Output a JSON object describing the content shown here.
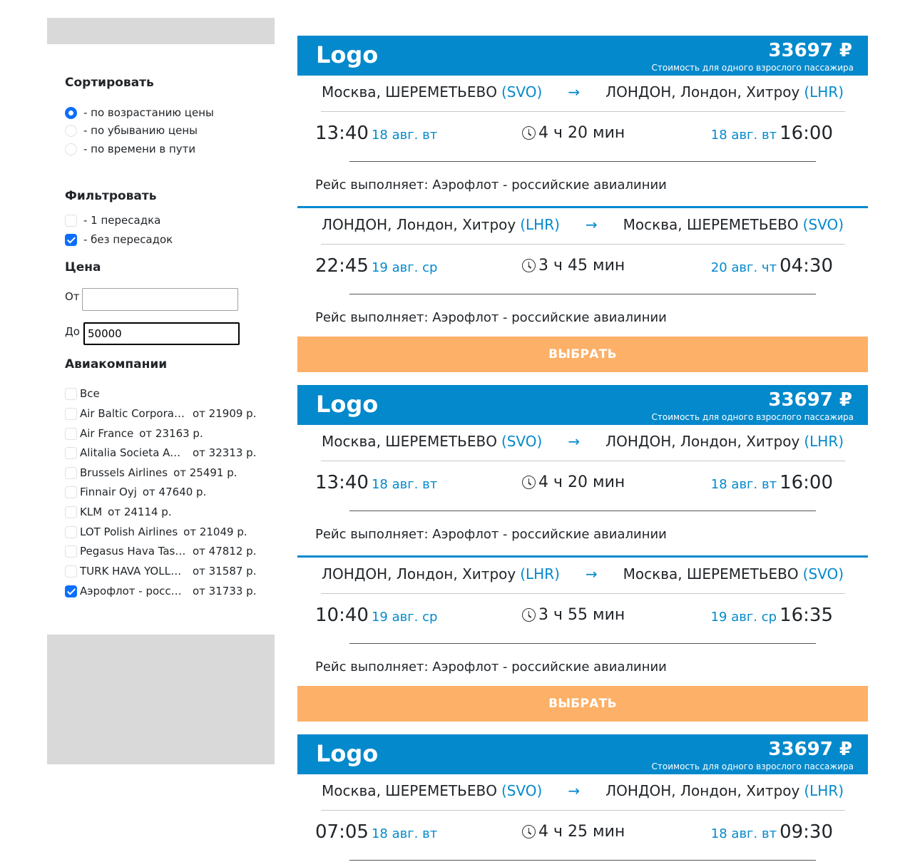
{
  "sidebar": {
    "sort_title": "Сортировать",
    "sort_options": [
      {
        "label": "- по возрастанию цены",
        "checked": true
      },
      {
        "label": "- по убыванию цены",
        "checked": false
      },
      {
        "label": "- по времени в пути",
        "checked": false
      }
    ],
    "filter_title": "Фильтровать",
    "filter_options": [
      {
        "label": "- 1 пересадка",
        "checked": false
      },
      {
        "label": "- без пересадок",
        "checked": true
      }
    ],
    "price_title": "Цена",
    "price_from_label": "От",
    "price_from_value": "",
    "price_to_label": "До",
    "price_to_value": "50000",
    "airlines_title": "Авиакомпании",
    "airlines": [
      {
        "name": "Все",
        "price": "",
        "checked": false
      },
      {
        "name": "Air Baltic Corporation",
        "price": "от 21909 р.",
        "checked": false
      },
      {
        "name": "Air France",
        "price": "от 23163 р.",
        "checked": false
      },
      {
        "name": "Alitalia Societa Aerea Italiana",
        "price": "от 32313 р.",
        "checked": false
      },
      {
        "name": "Brussels Airlines",
        "price": "от 25491 р.",
        "checked": false
      },
      {
        "name": "Finnair Oyj",
        "price": "от 47640 р.",
        "checked": false
      },
      {
        "name": "KLM",
        "price": "от 24114 р.",
        "checked": false
      },
      {
        "name": "LOT Polish Airlines",
        "price": "от 21049 р.",
        "checked": false
      },
      {
        "name": "Pegasus Hava Tasimaciligi",
        "price": "от 47812 р.",
        "checked": false
      },
      {
        "name": "TURK HAVA YOLLARI",
        "price": "от 31587 р.",
        "checked": false
      },
      {
        "name": "Аэрофлот - российские авиалинии",
        "price": "от 31733 р.",
        "checked": true
      }
    ]
  },
  "cards": [
    {
      "logo": "Logo",
      "price": "33697 ₽",
      "price_note": "Стоимость для одного взрослого пассажира",
      "button": "ВЫБРАТЬ",
      "legs": [
        {
          "from": "Москва, ШЕРЕМЕТЬЕВО",
          "from_code": "(SVO)",
          "arrow": "→",
          "to": "ЛОНДОН, Лондон, Хитроу",
          "to_code": "(LHR)",
          "dep_time": "13:40",
          "dep_date": "18 авг. вт",
          "duration": "4 ч 20 мин",
          "arr_date": "18 авг. вт",
          "arr_time": "16:00",
          "operator": "Рейс выполняет: Аэрофлот - российские авиалинии"
        },
        {
          "from": "ЛОНДОН, Лондон, Хитроу",
          "from_code": "(LHR)",
          "arrow": "→",
          "to": "Москва, ШЕРЕМЕТЬЕВО",
          "to_code": "(SVO)",
          "dep_time": "22:45",
          "dep_date": "19 авг. ср",
          "duration": "3 ч 45 мин",
          "arr_date": "20 авг. чт",
          "arr_time": "04:30",
          "operator": "Рейс выполняет: Аэрофлот - российские авиалинии"
        }
      ]
    },
    {
      "logo": "Logo",
      "price": "33697 ₽",
      "price_note": "Стоимость для одного взрослого пассажира",
      "button": "ВЫБРАТЬ",
      "legs": [
        {
          "from": "Москва, ШЕРЕМЕТЬЕВО",
          "from_code": "(SVO)",
          "arrow": "→",
          "to": "ЛОНДОН, Лондон, Хитроу",
          "to_code": "(LHR)",
          "dep_time": "13:40",
          "dep_date": "18 авг. вт",
          "duration": "4 ч 20 мин",
          "arr_date": "18 авг. вт",
          "arr_time": "16:00",
          "operator": "Рейс выполняет: Аэрофлот - российские авиалинии"
        },
        {
          "from": "ЛОНДОН, Лондон, Хитроу",
          "from_code": "(LHR)",
          "arrow": "→",
          "to": "Москва, ШЕРЕМЕТЬЕВО",
          "to_code": "(SVO)",
          "dep_time": "10:40",
          "dep_date": "19 авг. ср",
          "duration": "3 ч 55 мин",
          "arr_date": "19 авг. ср",
          "arr_time": "16:35",
          "operator": "Рейс выполняет: Аэрофлот - российские авиалинии"
        }
      ]
    },
    {
      "logo": "Logo",
      "price": "33697 ₽",
      "price_note": "Стоимость для одного взрослого пассажира",
      "legs": [
        {
          "from": "Москва, ШЕРЕМЕТЬЕВО",
          "from_code": "(SVO)",
          "arrow": "→",
          "to": "ЛОНДОН, Лондон, Хитроу",
          "to_code": "(LHR)",
          "dep_time": "07:05",
          "dep_date": "18 авг. вт",
          "duration": "4 ч 25 мин",
          "arr_date": "18 авг. вт",
          "arr_time": "09:30"
        }
      ]
    }
  ]
}
